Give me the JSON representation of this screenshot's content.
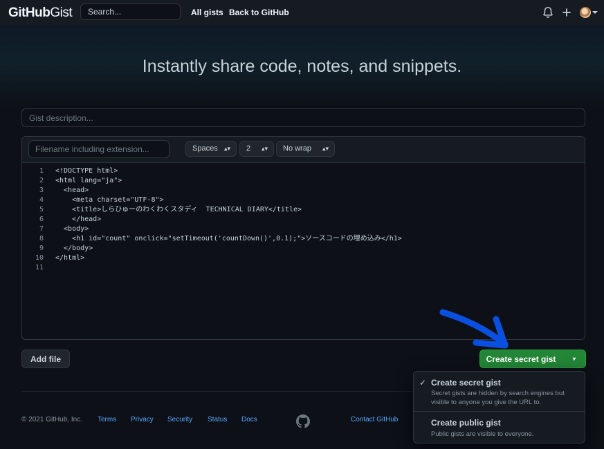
{
  "header": {
    "logo_bold": "GitHub",
    "logo_light": "Gist",
    "search_placeholder": "Search...",
    "nav_all_gists": "All gists",
    "nav_back": "Back to GitHub"
  },
  "hero": {
    "title": "Instantly share code, notes, and snippets."
  },
  "form": {
    "description_placeholder": "Gist description...",
    "filename_placeholder": "Filename including extension...",
    "indent_mode": "Spaces",
    "indent_size": "2",
    "wrap_mode": "No wrap"
  },
  "code_lines": [
    {
      "n": "1",
      "text": "<!DOCTYPE html>"
    },
    {
      "n": "2",
      "text": "<html lang=\"ja\">"
    },
    {
      "n": "3",
      "text": "  <head>"
    },
    {
      "n": "4",
      "text": "    <meta charset=\"UTF-8\">"
    },
    {
      "n": "5",
      "text": "    <title>しらひゅーのわくわくスタディ  TECHNICAL DIARY</title>"
    },
    {
      "n": "6",
      "text": "    </head>"
    },
    {
      "n": "7",
      "text": "  <body>"
    },
    {
      "n": "8",
      "text": "    <h1 id=\"count\" onclick=\"setTimeout('countDown()',0.1);\">ソースコードの埋め込み</h1>"
    },
    {
      "n": "9",
      "text": "  </body>"
    },
    {
      "n": "10",
      "text": "</html>"
    },
    {
      "n": "11",
      "text": ""
    }
  ],
  "actions": {
    "add_file": "Add file",
    "create_secret": "Create secret gist",
    "dropdown_caret": "▾"
  },
  "dropdown_menu": {
    "items": [
      {
        "title": "Create secret gist",
        "desc": "Secret gists are hidden by search engines but visible to anyone you give the URL to.",
        "selected": true
      },
      {
        "title": "Create public gist",
        "desc": "Public gists are visible to everyone.",
        "selected": false
      }
    ]
  },
  "footer": {
    "copyright": "© 2021 GitHub, Inc.",
    "links": [
      "Terms",
      "Privacy",
      "Security",
      "Status",
      "Docs"
    ],
    "contact": "Contact GitHub"
  },
  "colors": {
    "background": "#0d1117",
    "header": "#161b22",
    "primary_button": "#238636",
    "link": "#58a6ff",
    "annotation_arrow": "#0a4fe0"
  },
  "icons": [
    "bell-icon",
    "plus-icon",
    "caret-down-icon",
    "octocat-icon",
    "check-icon"
  ]
}
